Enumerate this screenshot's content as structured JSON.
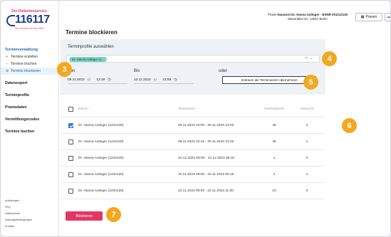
{
  "logo": {
    "top_text": "Der Patientenservice",
    "number": "116117",
    "bottom_text": "Die Nummer mit den Elfen"
  },
  "header": {
    "praxis_line1_prefix": "Praxis",
    "praxis_line1_name": "Hausarzt Dr. Hanna Aulinger - BSNR 001212130",
    "praxis_line2": "Mauerallee 6A, 14057 Berlin",
    "praxen_button": "Praxen",
    "logout_icon": "logout-icon"
  },
  "page_title": "Termine blockieren",
  "sidebar": {
    "groups": [
      {
        "title": "Terminverwaltung",
        "active": true
      },
      {
        "title": "Datenexport"
      },
      {
        "title": "Terminprofile"
      },
      {
        "title": "Praxisdaten"
      },
      {
        "title": "Vermittlungscodes"
      },
      {
        "title": "Termine buchen"
      }
    ],
    "sub_items": [
      {
        "icon": "+",
        "label": "Termine erstellen"
      },
      {
        "icon": "−",
        "label": "Termine löschen"
      },
      {
        "icon": "⊘",
        "label": "Termine blockieren"
      }
    ],
    "footer_links": [
      "Anleitungen",
      "FAQ",
      "Datenschutz",
      "Nutzungsbedingungen",
      "Kontakt"
    ]
  },
  "filter": {
    "profile_label": "Terminprofile auswählen",
    "profile_chip": "Dr. Hanna Aulinger (1...",
    "clear_icon": "×",
    "dropdown_icon": "⌄",
    "von_label": "Von",
    "bis_label": "Bis",
    "oder_label": "oder",
    "von_date": "09.11.2023",
    "von_time": "13:18",
    "bis_date": "23.11.2023",
    "bis_time": "23:59",
    "apply_button": "Zeitraum der Terminserien übernehmen"
  },
  "table": {
    "headers": {
      "name": "Name ↕",
      "zeit": "Terminzeit ↕",
      "frei": "Frei/Gebucht",
      "gebucht": "Gebucht"
    },
    "rows": [
      {
        "checked": true,
        "name": "Dr. Hanna Aulinger (1234130)",
        "zeit": "06.11.2023 10:00 - 30.11.2023 13:00",
        "frei": "48",
        "gebucht": "2"
      },
      {
        "checked": false,
        "name": "Dr. Hanna Aulinger (1234130)",
        "zeit": "06.11.2023 10:16 - 30.11.2023 13:16",
        "frei": "48",
        "gebucht": "1"
      },
      {
        "checked": false,
        "name": "Dr. Hanna Aulinger (1234130)",
        "zeit": "10.12.2023 09:00 - 10.12.2023 09:15",
        "frei": "1",
        "gebucht": "0"
      },
      {
        "checked": false,
        "name": "Dr. Hanna Aulinger (1234130)",
        "zeit": "10.11.2023 09:00 - 10.11.2023 09:15",
        "frei": "1",
        "gebucht": "1"
      },
      {
        "checked": false,
        "name": "Dr. Hanna Aulinger (1234130)",
        "zeit": "22.11.2023 09:00 - 22.11.2023 11:30",
        "frei": "10",
        "gebucht": "0"
      }
    ]
  },
  "block_button": "Blockieren",
  "markers": [
    "3",
    "4",
    "5",
    "6",
    "7"
  ],
  "colors": {
    "accent_blue": "#1769b8",
    "block_red": "#e23762",
    "chip_teal": "#7fd3c4",
    "marker_orange": "#f4a81f"
  }
}
